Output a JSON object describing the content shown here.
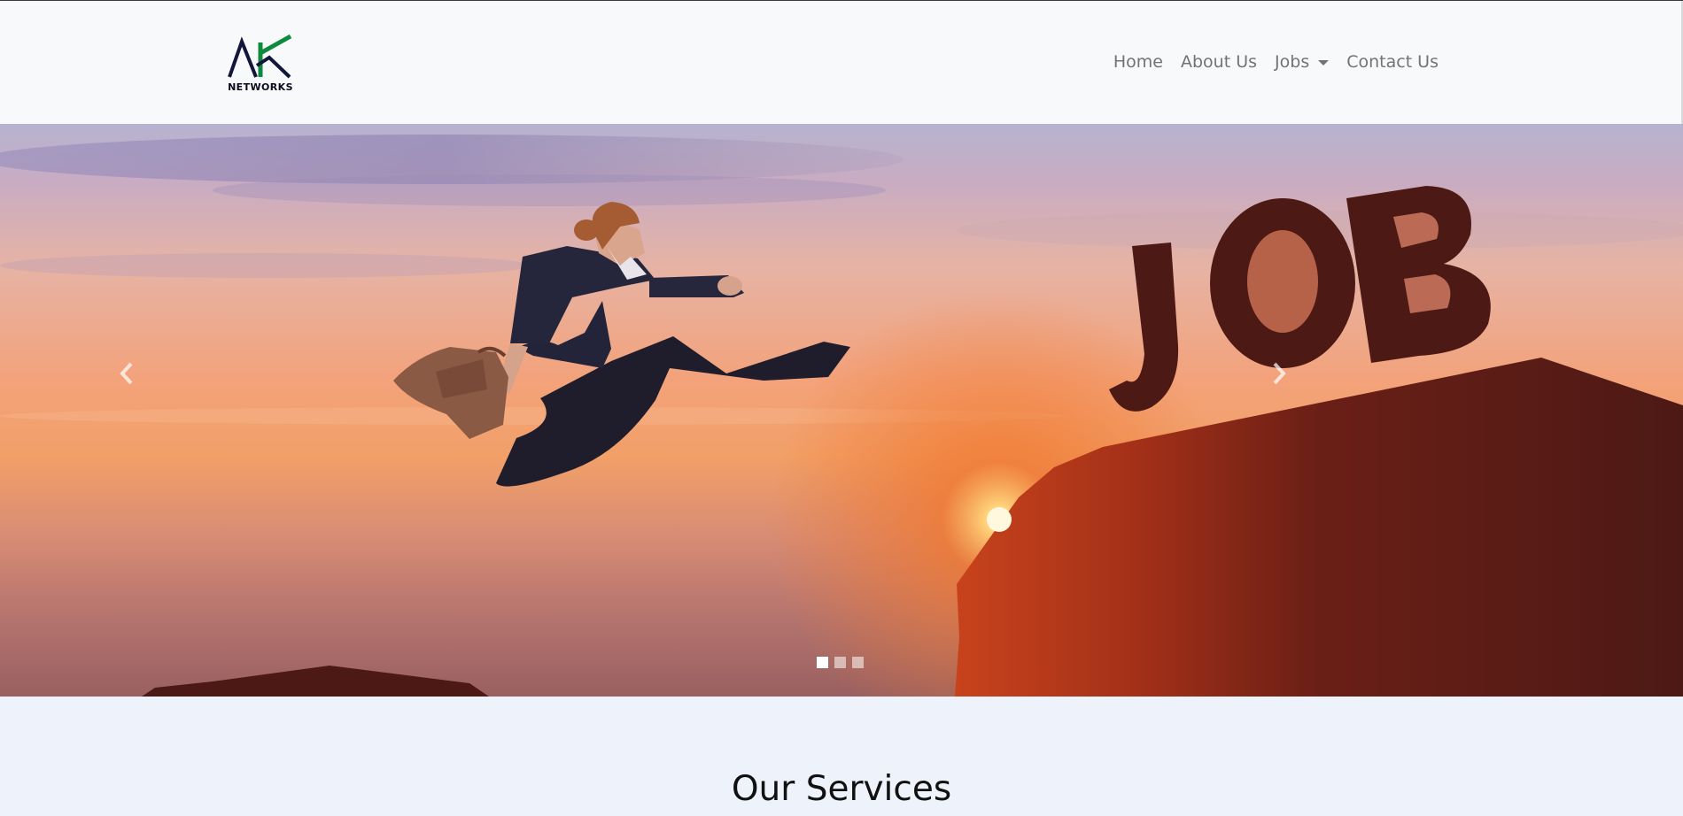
{
  "brand": {
    "logo_text": "NETWORKS",
    "name": "AK Networks"
  },
  "nav": {
    "home": "Home",
    "about": "About Us",
    "jobs": "Jobs",
    "contact": "Contact Us"
  },
  "carousel": {
    "slide_word": "JOB",
    "slide_count": 3,
    "active_index": 0,
    "prev_icon": "chevron-left-icon",
    "next_icon": "chevron-right-icon"
  },
  "services": {
    "heading": "Our Services"
  },
  "colors": {
    "logo_green": "#0e8a3e",
    "logo_navy": "#11163a",
    "silhouette": "#4d1915",
    "nav_text": "#737373"
  }
}
